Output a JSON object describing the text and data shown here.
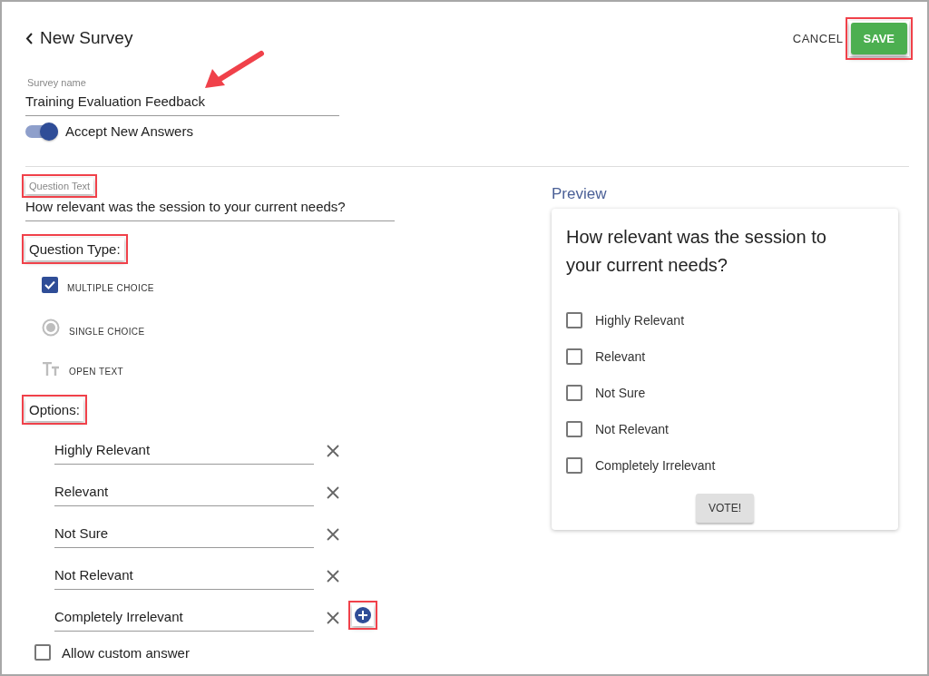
{
  "header": {
    "title": "New Survey",
    "cancel": "CANCEL",
    "save": {
      "label": "SAVE",
      "highlighted": true
    }
  },
  "survey_name": {
    "label": "Survey name",
    "value": "Training Evaluation Feedback",
    "annotated": true
  },
  "accept_answers": {
    "label": "Accept New Answers",
    "on": true
  },
  "question_text": {
    "label": "Question Text",
    "value": "How relevant was the session to your current needs?",
    "highlighted": true
  },
  "question_type": {
    "heading": "Question Type:",
    "highlighted": true,
    "types": [
      {
        "kind": "checkbox",
        "label": "MULTIPLE CHOICE",
        "selected": true
      },
      {
        "kind": "radio",
        "label": "SINGLE CHOICE",
        "selected": false
      },
      {
        "kind": "text",
        "label": "OPEN TEXT",
        "selected": false
      }
    ]
  },
  "options": {
    "heading": "Options:",
    "highlighted": true,
    "add_highlighted": true,
    "items": [
      "Highly Relevant",
      "Relevant",
      "Not Sure",
      "Not Relevant",
      "Completely Irrelevant"
    ]
  },
  "allow_custom": {
    "label": "Allow custom answer",
    "checked": false
  },
  "preview": {
    "title": "Preview",
    "question": "How relevant was the session to your current needs?",
    "choices": [
      {
        "label": "Highly Relevant",
        "checked": false
      },
      {
        "label": "Relevant",
        "checked": false
      },
      {
        "label": "Not Sure",
        "checked": false
      },
      {
        "label": "Not Relevant",
        "checked": false
      },
      {
        "label": "Completely Irrelevant",
        "checked": false
      }
    ],
    "vote": "VOTE!"
  }
}
